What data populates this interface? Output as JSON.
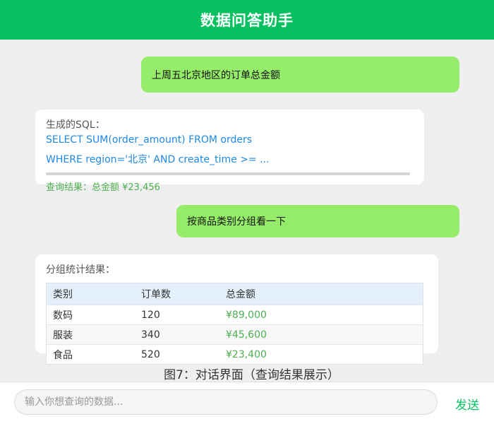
{
  "header": {
    "title": "数据问答助手"
  },
  "messages": {
    "user_1": "上周五北京地区的订单总金额",
    "reply_1": {
      "label": "生成的SQL：",
      "sql_line_1": "SELECT SUM(order_amount) FROM orders",
      "sql_line_2": "WHERE region='北京' AND create_time >= ...",
      "progress": 1.0,
      "result": "查询结果：总金额 ¥23,456"
    },
    "user_2": "按商品类别分组看一下",
    "reply_2": {
      "label": "分组统计结果：",
      "table": {
        "columns": [
          "类别",
          "订单数",
          "总金额"
        ],
        "rows": [
          [
            "数码",
            "120",
            "¥89,000"
          ],
          [
            "服装",
            "340",
            "¥45,600"
          ],
          [
            "食品",
            "520",
            "¥23,400"
          ]
        ]
      }
    }
  },
  "caption": "图7：对话界面（查询结果展示）",
  "input": {
    "placeholder": "输入你想查询的数据..."
  },
  "send_label": "发送",
  "colors": {
    "brand": "#07c160",
    "user_bubble": "#95ec69",
    "sql": "#1e88e5",
    "amount": "#4caf50"
  }
}
